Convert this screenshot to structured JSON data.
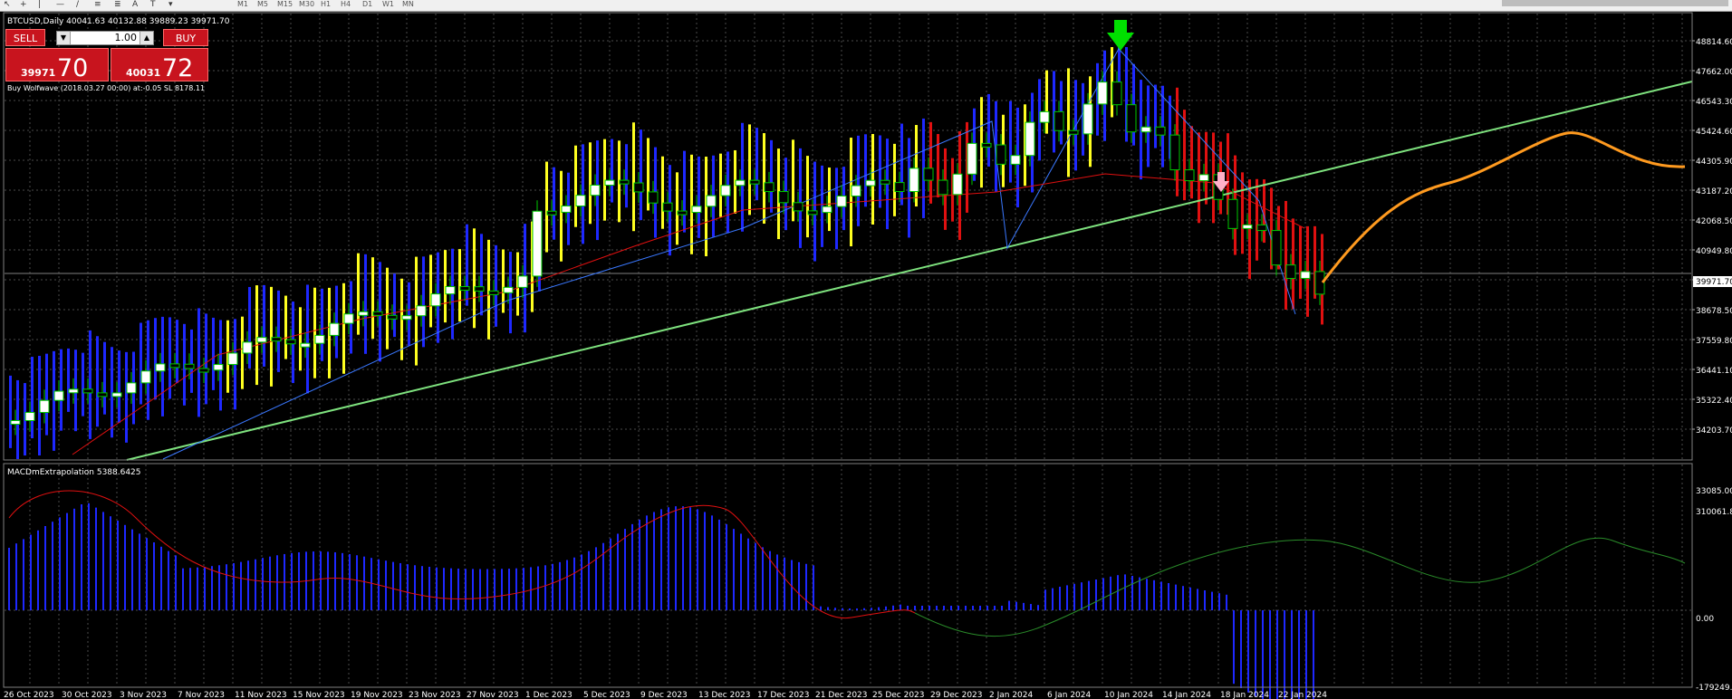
{
  "toolbar": {
    "timeframes": [
      "M1",
      "M5",
      "M15",
      "M30",
      "H1",
      "H4",
      "D1",
      "W1",
      "MN"
    ]
  },
  "chart": {
    "symbol_line": "BTCUSD,Daily  40041.63 40132.88 39889.23 39971.70",
    "wolfwave_note": "Buy Wolfwave (2018.03.27 00:00) at:-0.05 SL 8178.11",
    "current_price_label": "39971.70",
    "price_ticks": [
      "48814.60",
      "47662.00",
      "46543.30",
      "45424.60",
      "44305.90",
      "43187.20",
      "42068.50",
      "40949.80",
      "38678.50",
      "37559.80",
      "36441.10",
      "35322.40",
      "34203.70",
      "33085.00"
    ],
    "date_labels": [
      "26 Oct 2023",
      "30 Oct 2023",
      "3 Nov 2023",
      "7 Nov 2023",
      "11 Nov 2023",
      "15 Nov 2023",
      "19 Nov 2023",
      "23 Nov 2023",
      "27 Nov 2023",
      "1 Dec 2023",
      "5 Dec 2023",
      "9 Dec 2023",
      "13 Dec 2023",
      "17 Dec 2023",
      "21 Dec 2023",
      "25 Dec 2023",
      "29 Dec 2023",
      "2 Jan 2024",
      "6 Jan 2024",
      "10 Jan 2024",
      "14 Jan 2024",
      "18 Jan 2024",
      "22 Jan 2024"
    ],
    "colors": {
      "background": "#000000",
      "grid": "#4a4a4a",
      "bull_candle": "#ffffff",
      "bear_candle": "#000000",
      "candle_outline": "#00c800",
      "trend_line": "#7ee27e",
      "wave_line": "#3a78ff",
      "forecast": "#ff9a1f",
      "histogram_blue": "#1e28ff",
      "histogram_yellow": "#ffff20",
      "histogram_red": "#e01010",
      "signal_red": "#e01010",
      "signal_green": "#2a8c2a",
      "arrow_down": "#00e000",
      "arrow_pink": "#ffb0c8"
    }
  },
  "trade_panel": {
    "sell_label": "SELL",
    "buy_label": "BUY",
    "lot_value": "1.00",
    "sell_price_small": "39971",
    "sell_price_big": "70",
    "buy_price_small": "40031",
    "buy_price_big": "72"
  },
  "indicator": {
    "label": "MACDmExtrapolation 5388.6425",
    "ticks": [
      "310061.84",
      "0.00",
      "-179249.1"
    ]
  }
}
